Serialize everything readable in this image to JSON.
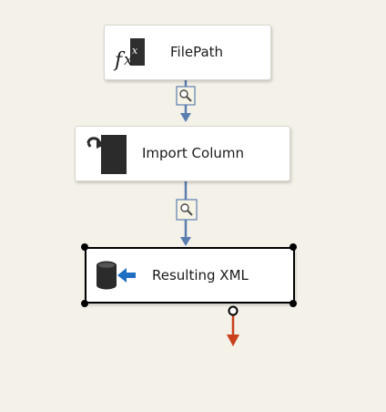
{
  "nodes": [
    {
      "id": "filepath",
      "label": "FilePath",
      "icon": "derived-column-fx-icon"
    },
    {
      "id": "import",
      "label": "Import Column",
      "icon": "import-column-icon"
    },
    {
      "id": "result",
      "label": "Resulting XML",
      "icon": "destination-icon",
      "selected": true
    }
  ],
  "colors": {
    "background": "#f4f1e8",
    "path_blue": "#5b7eb0",
    "error_path": "#c9401a"
  }
}
